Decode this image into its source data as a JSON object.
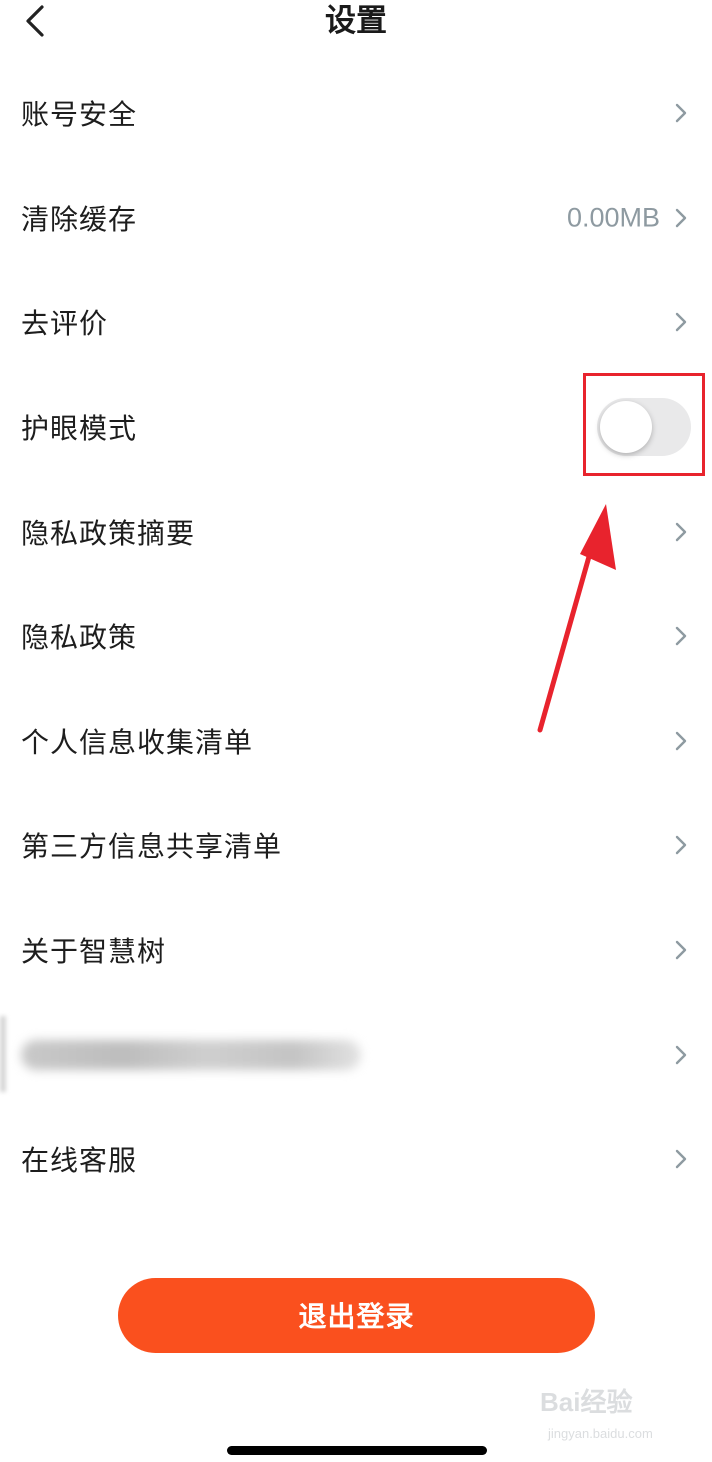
{
  "header": {
    "title": "设置"
  },
  "settings": [
    {
      "label": "账号安全"
    },
    {
      "label": "清除缓存",
      "value": "0.00MB"
    },
    {
      "label": "去评价"
    },
    {
      "label": "护眼模式",
      "toggle": false
    },
    {
      "label": "隐私政策摘要"
    },
    {
      "label": "隐私政策"
    },
    {
      "label": "个人信息收集清单"
    },
    {
      "label": "第三方信息共享清单"
    },
    {
      "label": "关于智慧树"
    },
    {
      "label": ""
    },
    {
      "label": "在线客服"
    }
  ],
  "logout": {
    "label": "退出登录"
  },
  "watermark": {
    "main": "Bai经验",
    "sub": "jingyan.baidu.com"
  },
  "colors": {
    "accent": "#fa501e",
    "annotation": "#e8232d",
    "chevron": "#8e9aa1",
    "toggle_off": "#e9e9ea"
  }
}
